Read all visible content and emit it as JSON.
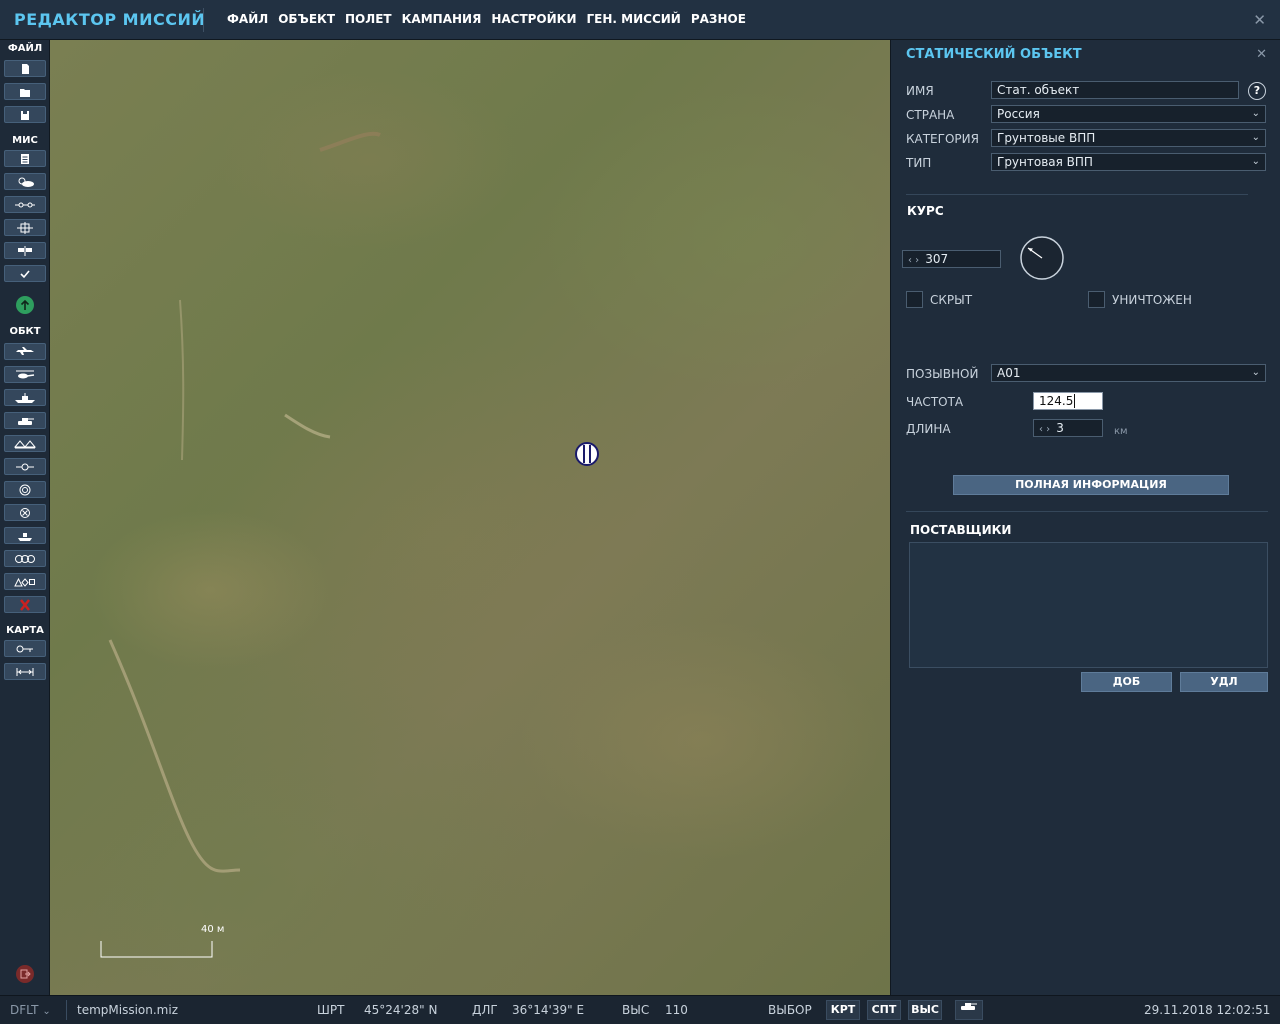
{
  "header": {
    "app_title": "РЕДАКТОР МИССИЙ",
    "menu": [
      "ФАЙЛ",
      "ОБЪЕКТ",
      "ПОЛЕТ",
      "КАМПАНИЯ",
      "НАСТРОЙКИ",
      "ГЕН. МИССИЙ",
      "РАЗНОЕ"
    ],
    "close_icon": "close-icon"
  },
  "toolbar": {
    "sections": {
      "file": "ФАЙЛ",
      "mission": "МИС",
      "objects": "ОБКТ",
      "map": "КАРТА"
    },
    "file_buttons": [
      "new-file-icon",
      "open-folder-icon",
      "save-icon"
    ],
    "mission_buttons": [
      "briefing-icon",
      "weather-icon",
      "triggers-icon",
      "target-icon",
      "flag-icon",
      "check-icon"
    ],
    "objects_buttons": [
      "plane-icon",
      "helicopter-icon",
      "ship-icon",
      "vehicle-icon",
      "static-object-icon",
      "waypoint-icon",
      "zone-icon",
      "nav-target-icon",
      "fob-icon",
      "group-icon",
      "shapes-icon",
      "delete-icon"
    ],
    "map_buttons": [
      "map-options-icon",
      "ruler-icon"
    ]
  },
  "map": {
    "scale_label": "40 м"
  },
  "panel": {
    "title": "СТАТИЧЕСКИЙ ОБЪЕКТ",
    "name_label": "ИМЯ",
    "name_value": "Стат. объект",
    "help_label": "?",
    "country_label": "СТРАНА",
    "country_value": "Россия",
    "category_label": "КАТЕГОРИЯ",
    "category_value": "Грунтовые ВПП",
    "type_label": "ТИП",
    "type_value": "Грунтовая ВПП",
    "heading_section": "КУРС",
    "heading_value": "307",
    "hidden_label": "СКРЫТ",
    "hidden_checked": false,
    "destroyed_label": "УНИЧТОЖЕН",
    "destroyed_checked": false,
    "callsign_label": "ПОЗЫВНОЙ",
    "callsign_value": "A01",
    "frequency_label": "ЧАСТОТА",
    "frequency_value": "124.5",
    "length_label": "ДЛИНА",
    "length_value": "3",
    "length_unit": "км",
    "full_info_button": "ПОЛНАЯ ИНФОРМАЦИЯ",
    "suppliers_section": "ПОСТАВЩИКИ",
    "add_button": "ДОБ",
    "delete_button": "УДЛ"
  },
  "statusbar": {
    "profile": "DFLT",
    "filename": "tempMission.miz",
    "lat_label": "ШРТ",
    "lat_value": "45°24'28\" N",
    "lon_label": "ДЛГ",
    "lon_value": "36°14'39\" E",
    "alt_label": "ВЫС",
    "alt_value": "110",
    "select_label": "ВЫБОР",
    "toggle_map": "КРТ",
    "toggle_sat": "СПТ",
    "toggle_alt": "ВЫС",
    "datetime": "29.11.2018 12:02:51"
  },
  "colors": {
    "accent": "#5cc6f0",
    "panel_bg": "#1f2c3b",
    "button": "#4a6582",
    "delete_red": "#cc2020",
    "go_green": "#2e9e5e"
  }
}
